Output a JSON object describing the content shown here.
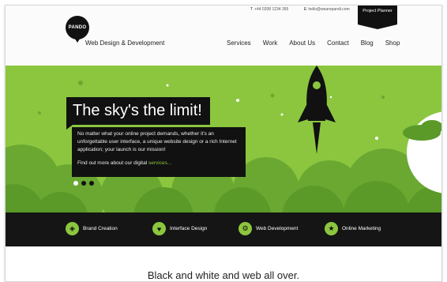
{
  "header": {
    "logo_text": "PANDO",
    "tagline": "Web Design & Development",
    "phone": "+44 0208 1234 355",
    "email": "hello@wearepandi.com",
    "phone_icon": "T",
    "email_icon": "E",
    "planner_label": "Project Planner"
  },
  "nav": [
    "Services",
    "Work",
    "About Us",
    "Contact",
    "Blog",
    "Shop"
  ],
  "hero": {
    "headline": "The sky's the limit!",
    "body": "No matter what your online project demands, whether it's an unforgettable user interface, a unique website design or a rich Internet application; your launch is our mission!",
    "more_prefix": "Find out more about our digital",
    "more_link": "services...",
    "slides": 3,
    "active_slide": 1
  },
  "services": [
    {
      "label": "Brand Creation",
      "icon": "globe-icon"
    },
    {
      "label": "Interface Design",
      "icon": "heart-icon"
    },
    {
      "label": "Web Development",
      "icon": "gear-icon"
    },
    {
      "label": "Online Marketing",
      "icon": "star-icon"
    }
  ],
  "footer_heading": "Black and white and web all over.",
  "colors": {
    "accent": "#8cc63f",
    "dark": "#111111",
    "background": "#fbfbfb"
  }
}
